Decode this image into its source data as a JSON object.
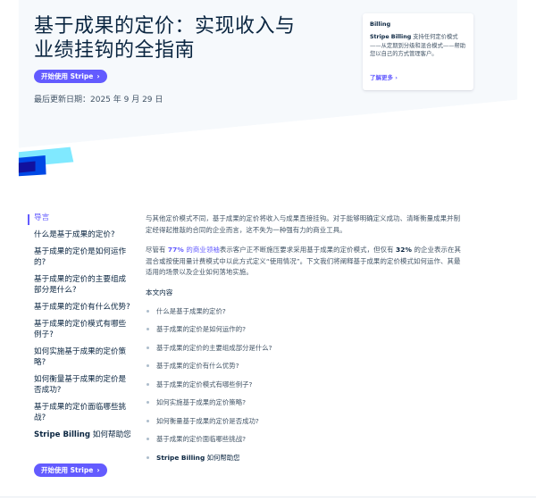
{
  "hero": {
    "title_line1": "基于成果的定价：实现收入与",
    "title_line2": "业绩挂钩的全指南",
    "cta_label": "开始使用 Stripe",
    "updated": "最后更新日期：2025 年 9 月 29 日"
  },
  "card": {
    "label": "Billing",
    "brand": "Stripe Billing",
    "body": " 支持任何定价模式——从定期到分级和混合模式——帮助您以自己的方式管理客户。",
    "link": "了解更多"
  },
  "sidebar": {
    "items": [
      {
        "label": "导言"
      },
      {
        "label": "什么是基于成果的定价?"
      },
      {
        "label": "基于成果的定价是如何运作的?"
      },
      {
        "label": "基于成果的定价的主要组成部分是什么?"
      },
      {
        "label": "基于成果的定价有什么优势?"
      },
      {
        "label": "基于成果的定价模式有哪些例子?"
      },
      {
        "label": "如何实施基于成果的定价策略?"
      },
      {
        "label": "如何衡量基于成果的定价是否成功?"
      },
      {
        "label": "基于成果的定价面临哪些挑战?"
      }
    ],
    "brand_item": {
      "brand": "Stripe Billing",
      "rest": " 如何帮助您"
    },
    "cta_label": "开始使用 Stripe"
  },
  "main": {
    "para1": "与其他定价模式不同，基于成果的定价将收入与成果直接挂钩。对于能够明确定义成功、清晰衡量成果并制定经得起推敲的合同的企业而言，这不失为一种强有力的商业工具。",
    "para2": {
      "pre": "尽管有 ",
      "stat1": "77%",
      "link": " 的商业领袖",
      "mid": "表示客户正不断施压要求采用基于成果的定价模式，但仅有 ",
      "stat2": "32%",
      "post": " 的企业表示在其混合或按使用量计费模式中以此方式定义“使用情况”。下文我们将阐释基于成果的定价模式如何运作、其最适用的场景以及企业如何落地实施。"
    },
    "toc_heading": "本文内容",
    "toc": [
      "什么是基于成果的定价?",
      "基于成果的定价是如何运作的?",
      "基于成果的定价的主要组成部分是什么?",
      "基于成果的定价有什么优势?",
      "基于成果的定价模式有哪些例子?",
      "如何实施基于成果的定价策略?",
      "如何衡量基于成果的定价是否成功?",
      "基于成果的定价面临哪些挑战?"
    ],
    "toc_brand": {
      "brand": "Stripe Billing",
      "rest": " 如何帮助您"
    }
  },
  "colors": {
    "accent": "#635bff",
    "heading": "#0a2540",
    "body": "#425466",
    "stripe_cyan": "#80e9ff",
    "stripe_blue": "#0048e5"
  },
  "icons": {
    "chevron": "chevron-right-icon",
    "bullet": "bullet-icon"
  }
}
